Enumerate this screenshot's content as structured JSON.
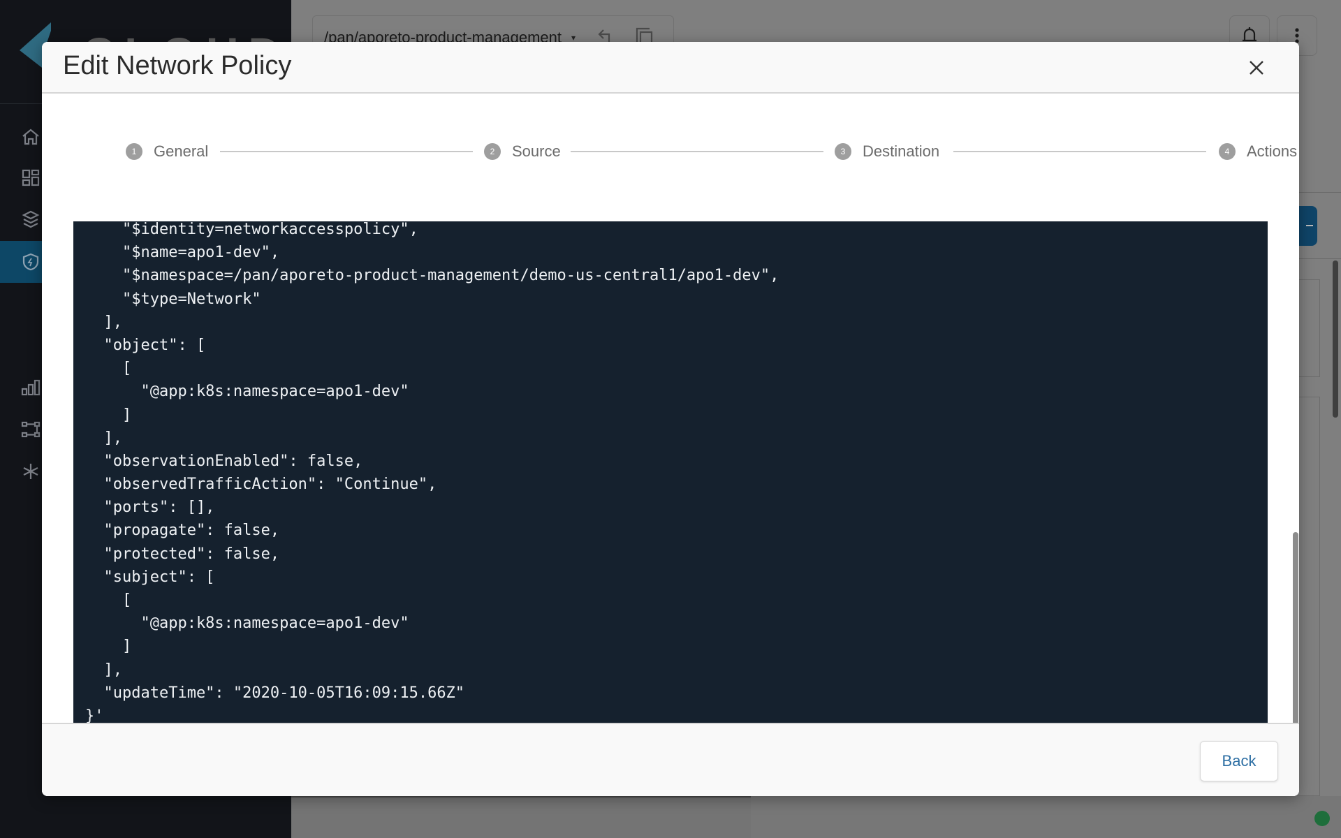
{
  "app": {
    "logo_text": "CLOUD",
    "namespace_selector": {
      "value": "/pan/aporeto-product-management",
      "caret": "▾"
    },
    "sidebar": {
      "items": [
        {
          "name": "home",
          "icon": "home-icon",
          "active": false
        },
        {
          "name": "dashboard",
          "icon": "dashboard-icon",
          "active": false
        },
        {
          "name": "layers",
          "icon": "layers-icon",
          "active": false
        },
        {
          "name": "network-security",
          "icon": "shield-bolt-icon",
          "active": true
        },
        {
          "name": "monitoring",
          "icon": "bar-chart-icon",
          "active": false
        },
        {
          "name": "topology",
          "icon": "topology-icon",
          "active": false
        },
        {
          "name": "integrations",
          "icon": "asterisk-icon",
          "active": false
        }
      ]
    },
    "colors": {
      "sidebar_active": "#0d4766",
      "accent_blue": "#2c6ea3",
      "code_bg": "#15212e",
      "status_ok": "#1e6e3b"
    }
  },
  "modal": {
    "title": "Edit Network Policy",
    "close_icon": "close-icon",
    "steps": [
      {
        "number": "1",
        "label": "General"
      },
      {
        "number": "2",
        "label": "Source"
      },
      {
        "number": "3",
        "label": "Destination"
      },
      {
        "number": "4",
        "label": "Actions"
      }
    ],
    "code_lines": [
      "    \"$identity=networkaccesspolicy\",",
      "    \"$name=apo1-dev\",",
      "    \"$namespace=/pan/aporeto-product-management/demo-us-central1/apo1-dev\",",
      "    \"$type=Network\"",
      "  ],",
      "  \"object\": [",
      "    [",
      "      \"@app:k8s:namespace=apo1-dev\"",
      "    ]",
      "  ],",
      "  \"observationEnabled\": false,",
      "  \"observedTrafficAction\": \"Continue\",",
      "  \"ports\": [],",
      "  \"propagate\": false,",
      "  \"protected\": false,",
      "  \"subject\": [",
      "    [",
      "      \"@app:k8s:namespace=apo1-dev\"",
      "    ]",
      "  ],",
      "  \"updateTime\": \"2020-10-05T16:09:15.66Z\"",
      "}'"
    ],
    "footer": {
      "back_label": "Back"
    }
  }
}
